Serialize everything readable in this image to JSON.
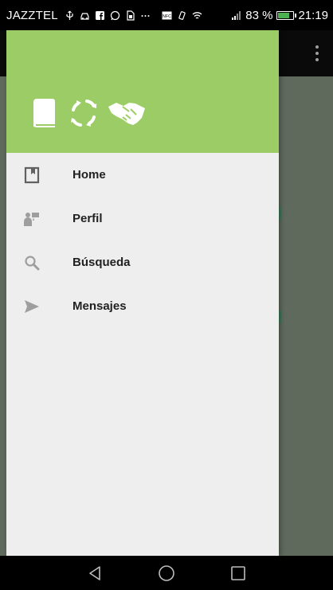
{
  "status_bar": {
    "carrier": "JAZZTEL",
    "battery_percent_text": "83 %",
    "battery_level": 0.83,
    "time": "21:19",
    "icons": [
      "usb-icon",
      "car-icon",
      "facebook-icon",
      "whatsapp-icon",
      "sim-icon",
      "more-icon",
      "nfc-icon",
      "vibrate-icon",
      "wifi-icon",
      "signal-icon",
      "battery-icon"
    ]
  },
  "drawer": {
    "header_color": "#9ccc65",
    "logo_icons": [
      "book-icon",
      "sync-icon",
      "handshake-icon"
    ],
    "items": [
      {
        "label": "Home",
        "icon": "home-bookmark-icon"
      },
      {
        "label": "Perfil",
        "icon": "profile-icon"
      },
      {
        "label": "Búsqueda",
        "icon": "search-icon"
      },
      {
        "label": "Mensajes",
        "icon": "send-icon"
      }
    ]
  },
  "nav_bar": {
    "buttons": [
      "back-icon",
      "home-icon",
      "recents-icon"
    ]
  }
}
